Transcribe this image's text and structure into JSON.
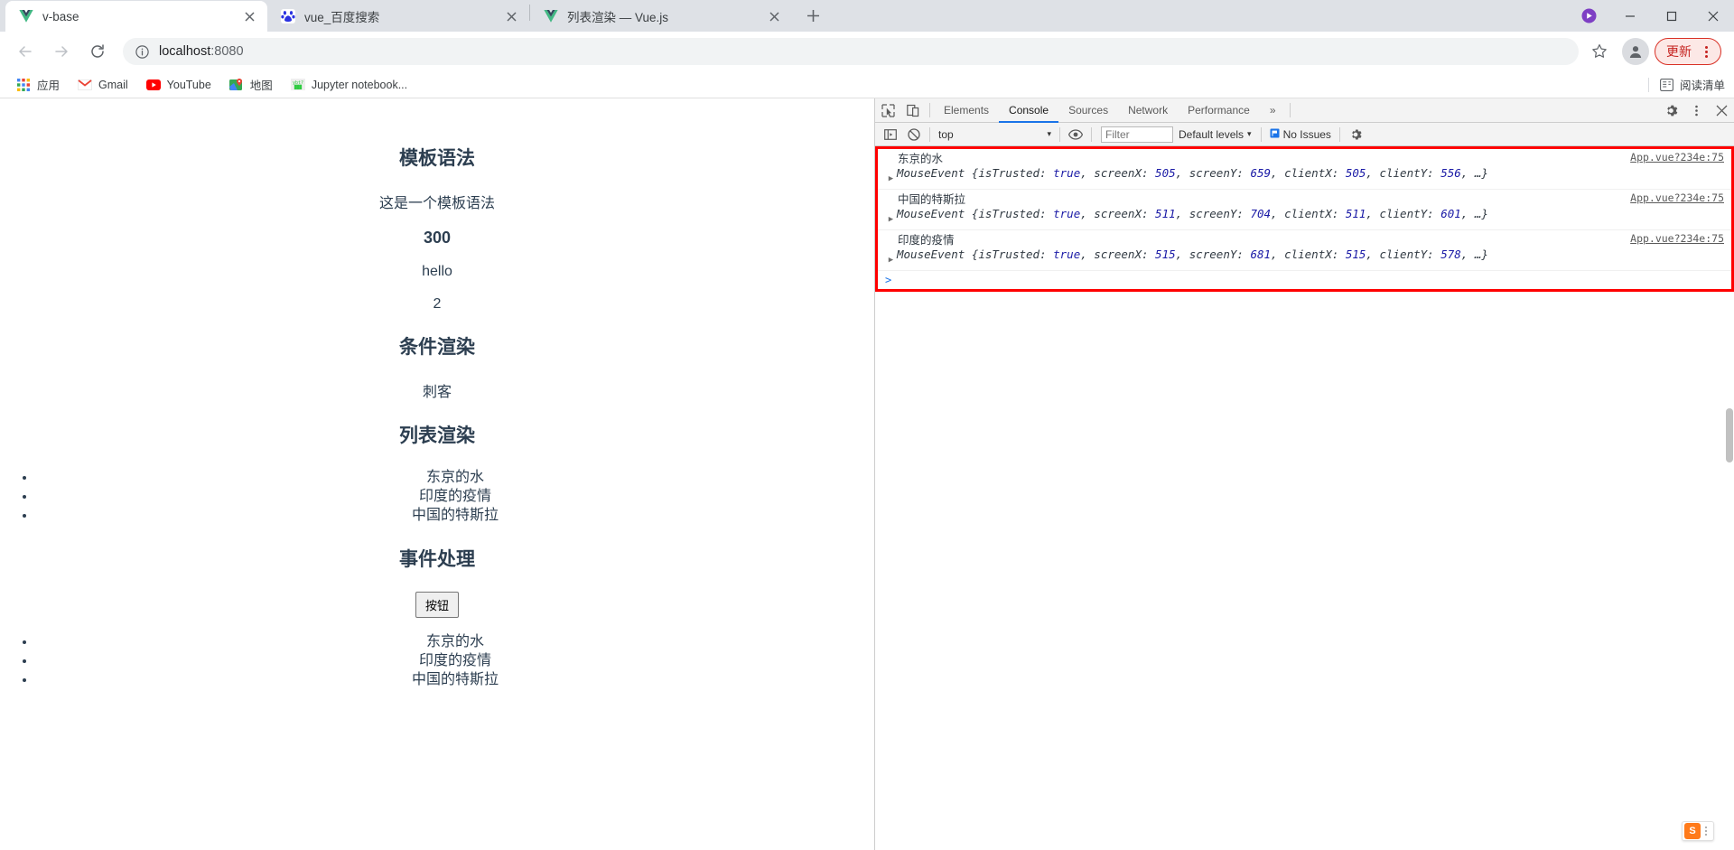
{
  "browser": {
    "tabs": [
      {
        "title": "v-base",
        "favicon": "vue-icon",
        "active": true
      },
      {
        "title": "vue_百度搜索",
        "favicon": "baidu-icon",
        "active": false
      },
      {
        "title": "列表渲染 — Vue.js",
        "favicon": "vue-icon",
        "active": false
      }
    ],
    "new_tab_label": "+",
    "window_controls": {
      "minimize": "–",
      "maximize": "▢",
      "close": "✕"
    },
    "toolbar": {
      "back": "←",
      "forward": "→",
      "reload": "⟳",
      "url": "localhost",
      "url_port": ":8080",
      "bookmark_star": "☆",
      "update_label": "更新"
    },
    "bookmarks": [
      {
        "label": "应用",
        "icon": "apps-grid-icon"
      },
      {
        "label": "Gmail",
        "icon": "gmail-icon"
      },
      {
        "label": "YouTube",
        "icon": "youtube-icon"
      },
      {
        "label": "地图",
        "icon": "maps-icon"
      },
      {
        "label": "Jupyter notebook...",
        "icon": "jupyter-icon"
      }
    ],
    "reading_list": {
      "label": "阅读清单",
      "icon": "reading-list-icon"
    }
  },
  "page": {
    "sections": [
      {
        "type": "h2",
        "text": "模板语法"
      },
      {
        "type": "p",
        "text": "这是一个模板语法"
      },
      {
        "type": "p-bold",
        "text": "300"
      },
      {
        "type": "p",
        "text": "hello"
      },
      {
        "type": "p",
        "text": "2"
      },
      {
        "type": "h2",
        "text": "条件渲染"
      },
      {
        "type": "p",
        "text": "刺客"
      },
      {
        "type": "h2",
        "text": "列表渲染"
      }
    ],
    "list_one": [
      "东京的水",
      "印度的疫情",
      "中国的特斯拉"
    ],
    "event_heading": "事件处理",
    "button_label": "按钮",
    "list_two": [
      "东京的水",
      "印度的疫情",
      "中国的特斯拉"
    ]
  },
  "devtools": {
    "tabs": [
      {
        "label": "Elements",
        "active": false
      },
      {
        "label": "Console",
        "active": true
      },
      {
        "label": "Sources",
        "active": false
      },
      {
        "label": "Network",
        "active": false
      },
      {
        "label": "Performance",
        "active": false
      }
    ],
    "more_tabs": "»",
    "icons": {
      "inspect": "inspect-cursor-icon",
      "device": "device-toolbar-icon",
      "settings": "gear-icon",
      "more": "kebab-menu-icon",
      "close": "close-icon"
    },
    "console_toolbar": {
      "sidebar_toggle": "console-sidebar-icon",
      "clear": "clear-console-icon",
      "context": "top",
      "context_caret": "▾",
      "eye": "live-expression-icon",
      "filter_placeholder": "Filter",
      "levels": "Default levels",
      "levels_caret": "▾",
      "issues": "No Issues",
      "issues_icon": "issues-flag-icon",
      "settings": "gear-icon"
    },
    "logs": [
      {
        "label": "东京的水",
        "source": "App.vue?234e:75",
        "class_name": "MouseEvent",
        "props": [
          {
            "key": "isTrusted",
            "value": "true"
          },
          {
            "key": "screenX",
            "value": "505"
          },
          {
            "key": "screenY",
            "value": "659"
          },
          {
            "key": "clientX",
            "value": "505"
          },
          {
            "key": "clientY",
            "value": "556"
          }
        ],
        "ellipsis": "…"
      },
      {
        "label": "中国的特斯拉",
        "source": "App.vue?234e:75",
        "class_name": "MouseEvent",
        "props": [
          {
            "key": "isTrusted",
            "value": "true"
          },
          {
            "key": "screenX",
            "value": "511"
          },
          {
            "key": "screenY",
            "value": "704"
          },
          {
            "key": "clientX",
            "value": "511"
          },
          {
            "key": "clientY",
            "value": "601"
          }
        ],
        "ellipsis": "…"
      },
      {
        "label": "印度的疫情",
        "source": "App.vue?234e:75",
        "class_name": "MouseEvent",
        "props": [
          {
            "key": "isTrusted",
            "value": "true"
          },
          {
            "key": "screenX",
            "value": "515"
          },
          {
            "key": "screenY",
            "value": "681"
          },
          {
            "key": "clientX",
            "value": "515"
          },
          {
            "key": "clientY",
            "value": "578"
          }
        ],
        "ellipsis": "…"
      }
    ],
    "prompt": ">",
    "highlight_color": "#ff0000"
  },
  "overlay": {
    "sogou_label": "S"
  }
}
